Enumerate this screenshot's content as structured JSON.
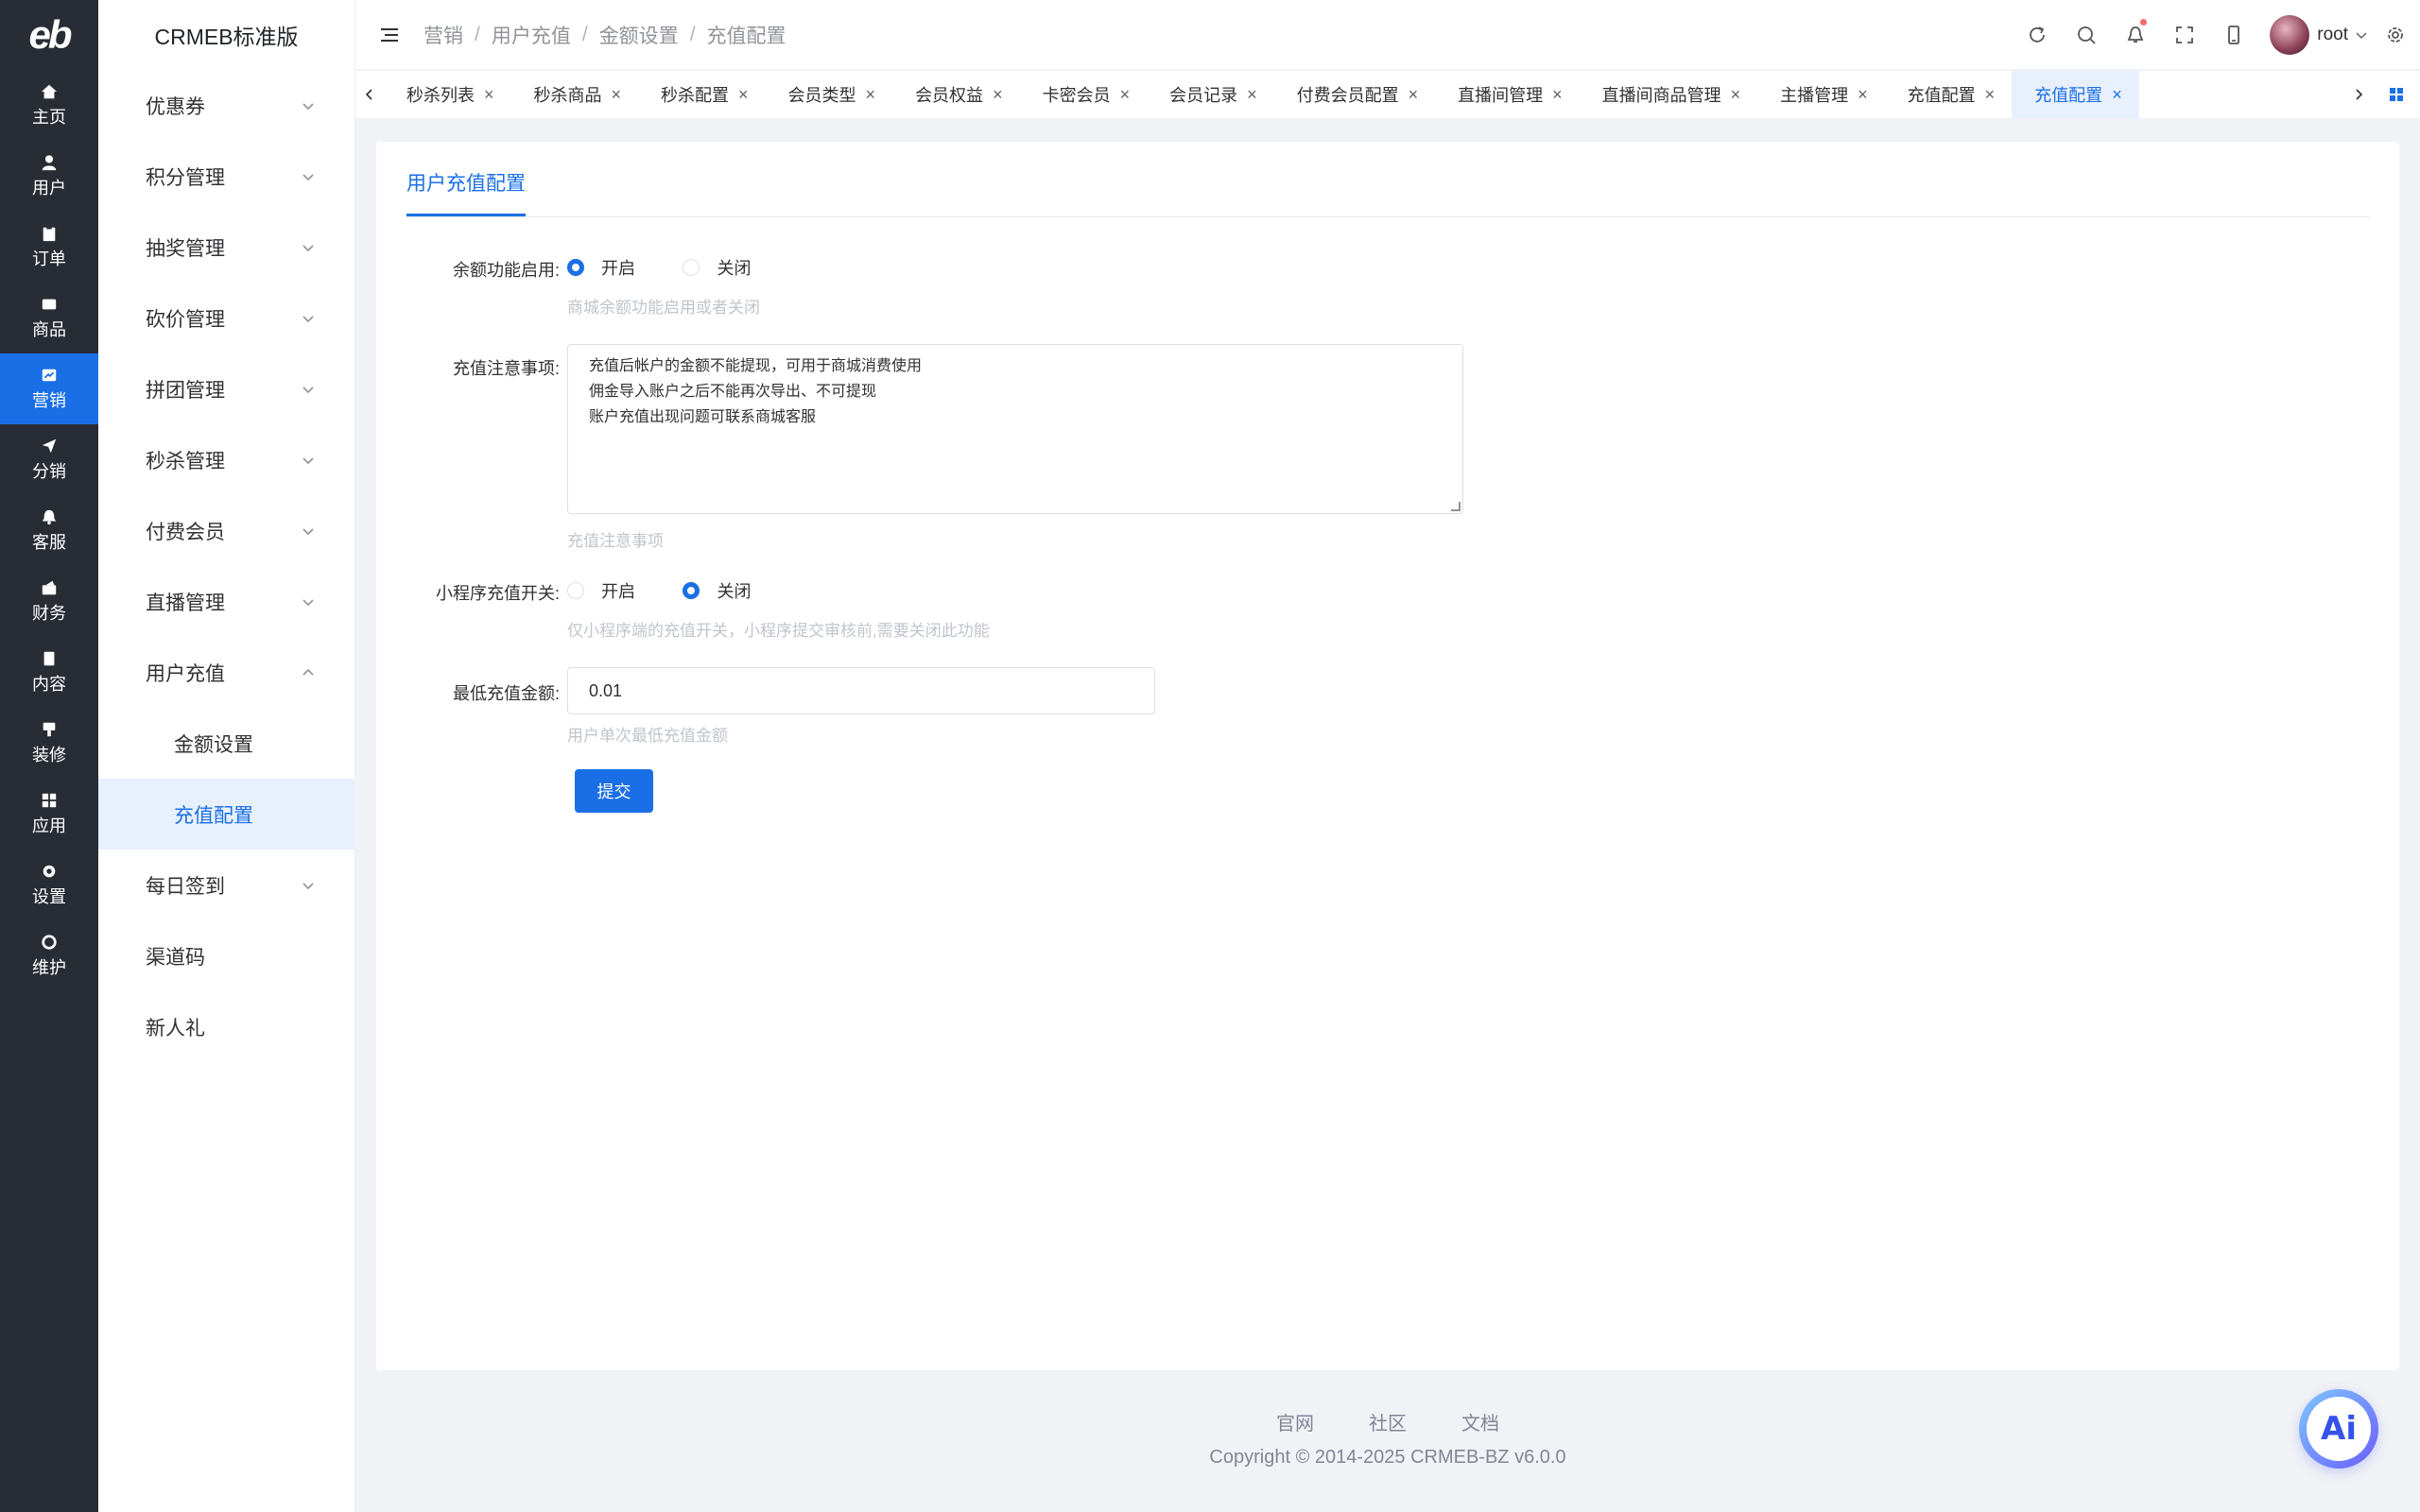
{
  "rail": {
    "logo": "eb",
    "items": [
      {
        "label": "主页",
        "icon": "home-icon"
      },
      {
        "label": "用户",
        "icon": "user-icon"
      },
      {
        "label": "订单",
        "icon": "order-icon"
      },
      {
        "label": "商品",
        "icon": "product-icon"
      },
      {
        "label": "营销",
        "icon": "marketing-icon"
      },
      {
        "label": "分销",
        "icon": "distribution-icon"
      },
      {
        "label": "客服",
        "icon": "service-icon"
      },
      {
        "label": "财务",
        "icon": "finance-icon"
      },
      {
        "label": "内容",
        "icon": "content-icon"
      },
      {
        "label": "装修",
        "icon": "decoration-icon"
      },
      {
        "label": "应用",
        "icon": "apps-icon"
      },
      {
        "label": "设置",
        "icon": "settings-icon"
      },
      {
        "label": "维护",
        "icon": "maintenance-icon"
      }
    ],
    "active_index": 4
  },
  "submenu": {
    "title": "CRMEB标准版",
    "items": [
      {
        "label": "优惠券"
      },
      {
        "label": "积分管理"
      },
      {
        "label": "抽奖管理"
      },
      {
        "label": "砍价管理"
      },
      {
        "label": "拼团管理"
      },
      {
        "label": "秒杀管理"
      },
      {
        "label": "付费会员"
      },
      {
        "label": "直播管理"
      },
      {
        "label": "用户充值"
      },
      {
        "label": "金额设置"
      },
      {
        "label": "充值配置"
      },
      {
        "label": "每日签到"
      },
      {
        "label": "渠道码"
      },
      {
        "label": "新人礼"
      }
    ]
  },
  "breadcrumb": [
    "营销",
    "用户充值",
    "金额设置",
    "充值配置"
  ],
  "header": {
    "username": "root"
  },
  "tabs": [
    "秒杀列表",
    "秒杀商品",
    "秒杀配置",
    "会员类型",
    "会员权益",
    "卡密会员",
    "会员记录",
    "付费会员配置",
    "直播间管理",
    "直播间商品管理",
    "主播管理",
    "充值配置",
    "充值配置"
  ],
  "card": {
    "tab_label": "用户充值配置",
    "balance": {
      "label": "余额功能启用:",
      "options": [
        "开启",
        "关闭"
      ],
      "selected": "开启",
      "hint": "商城余额功能启用或者关闭"
    },
    "notice": {
      "label": "充值注意事项:",
      "value": "充值后帐户的金额不能提现，可用于商城消费使用\n佣金导入账户之后不能再次导出、不可提现\n账户充值出现问题可联系商城客服",
      "hint": "充值注意事项"
    },
    "mini": {
      "label": "小程序充值开关:",
      "options": [
        "开启",
        "关闭"
      ],
      "selected": "关闭",
      "hint": "仅小程序端的充值开关，小程序提交审核前,需要关闭此功能"
    },
    "min_amount": {
      "label": "最低充值金额:",
      "value": "0.01",
      "hint": "用户单次最低充值金额"
    },
    "submit": "提交"
  },
  "footer": {
    "links": [
      "官网",
      "社区",
      "文档"
    ],
    "copyright": "Copyright © 2014-2025 CRMEB-BZ v6.0.0"
  },
  "ai_button": "Ai",
  "colors": {
    "primary": "#1a6fe6",
    "rail": "#282c34"
  }
}
